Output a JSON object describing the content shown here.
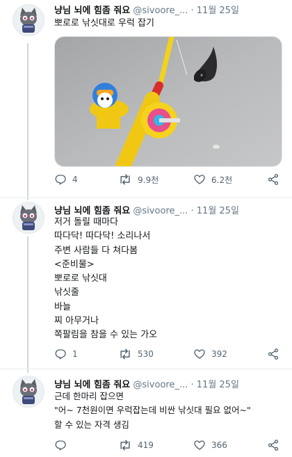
{
  "tweets": [
    {
      "name": "냥님 뇌에 힘좀 줘요",
      "handle": "@sivoore_...",
      "dot": "·",
      "time": "11월 25일",
      "text": "뽀로로 낚싯대로 우럭 잡기",
      "actions": {
        "replies": "4",
        "retweets": "9.9천",
        "likes": "6.2천"
      }
    },
    {
      "name": "냥님 뇌에 힘좀 줘요",
      "handle": "@sivoore_...",
      "dot": "·",
      "time": "11월 25일",
      "text": "저거 돌릴 때마다\n따다닥! 따다닥! 소리나서\n주변 사람들 다 쳐다봄\n<준비물>\n뽀로로 낚싯대\n낚싯줄\n바늘\n찌 아무거나\n쪽팔림을 참을 수 있는 가오",
      "actions": {
        "replies": "1",
        "retweets": "530",
        "likes": "392"
      }
    },
    {
      "name": "냥님 뇌에 힘좀 줘요",
      "handle": "@sivoore_...",
      "dot": "·",
      "time": "11월 25일",
      "text": "근데 한마리 잡으면\n\"어~ 7천원이면 우럭잡는데 비싼 낚싯대 필요 없어~\"\n할 수 있는 자격 생김",
      "actions": {
        "replies": "",
        "retweets": "419",
        "likes": "366"
      }
    }
  ],
  "icons": {
    "reply": "reply-icon",
    "retweet": "retweet-icon",
    "like": "heart-icon",
    "share": "share-icon"
  },
  "colors": {
    "icon": "#536471",
    "muted": "#657786",
    "text": "#14171a",
    "thread": "#cfd9de"
  }
}
